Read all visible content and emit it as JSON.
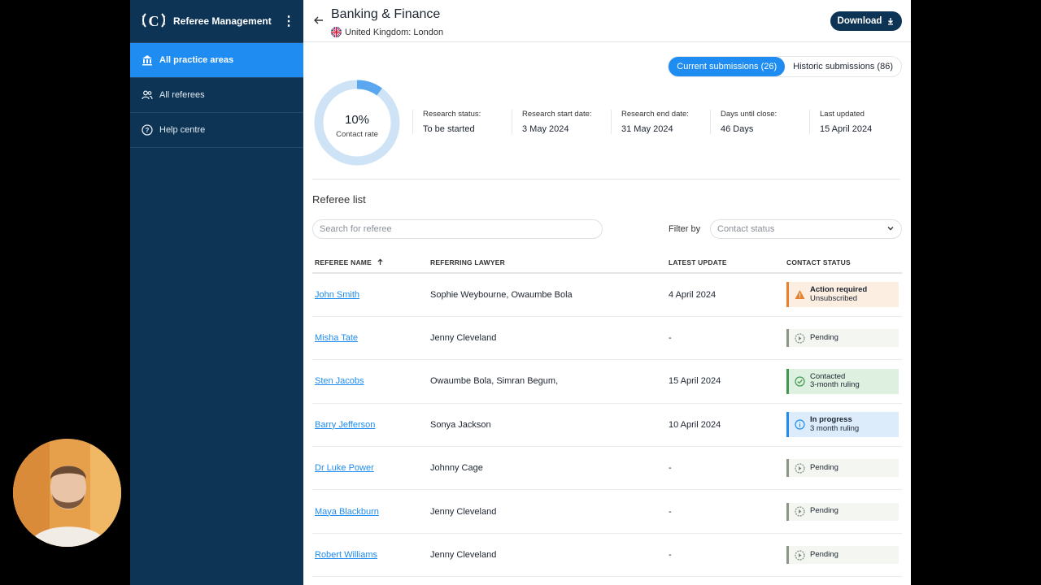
{
  "app": {
    "title": "Referee Management"
  },
  "sidebar": {
    "items": [
      {
        "label": "All practice areas",
        "icon": "bank-icon",
        "active": true
      },
      {
        "label": "All referees",
        "icon": "users-icon",
        "active": false
      },
      {
        "label": "Help centre",
        "icon": "help-icon",
        "active": false
      }
    ]
  },
  "header": {
    "title": "Banking & Finance",
    "location": "United Kingdom: London",
    "download_label": "Download"
  },
  "submissions": {
    "current": "Current submissions (26)",
    "historic": "Historic submissions (86)"
  },
  "contact_rate": {
    "value": "10%",
    "fraction": 0.1,
    "label": "Contact rate"
  },
  "stats": [
    {
      "label": "Research status:",
      "value": "To be started"
    },
    {
      "label": "Research start date:",
      "value": "3 May 2024"
    },
    {
      "label": "Research end date:",
      "value": "31 May 2024"
    },
    {
      "label": "Days until close:",
      "value": "46 Days"
    },
    {
      "label": "Last updated",
      "value": "15 April 2024"
    }
  ],
  "referee_list": {
    "title": "Referee list",
    "search_placeholder": "Search for referee",
    "filter_label": "Filter by",
    "filter_value": "Contact status",
    "columns": [
      "REFEREE NAME",
      "REFERRING LAWYER",
      "LATEST UPDATE",
      "CONTACT STATUS"
    ],
    "rows": [
      {
        "name": "John Smith",
        "lawyer": "Sophie Weybourne, Owaumbe Bola",
        "update": "4 April 2024",
        "status": "Action required",
        "status_sub": "Unsubscribed"
      },
      {
        "name": "Misha Tate",
        "lawyer": "Jenny Cleveland",
        "update": "-",
        "status": "Pending",
        "status_sub": ""
      },
      {
        "name": "Sten Jacobs",
        "lawyer": "Owaumbe Bola, Simran Begum,",
        "update": "15 April 2024",
        "status": "Contacted",
        "status_sub": "3-month ruling"
      },
      {
        "name": "Barry Jefferson",
        "lawyer": "Sonya Jackson",
        "update": "10 April 2024",
        "status": "In progress",
        "status_sub": "3 month ruling"
      },
      {
        "name": "Dr Luke Power",
        "lawyer": "Johnny Cage",
        "update": "-",
        "status": "Pending",
        "status_sub": ""
      },
      {
        "name": "Maya Blackburn",
        "lawyer": "Jenny Cleveland",
        "update": "-",
        "status": "Pending",
        "status_sub": ""
      },
      {
        "name": "Robert Williams",
        "lawyer": "Jenny Cleveland",
        "update": "-",
        "status": "Pending",
        "status_sub": ""
      }
    ]
  },
  "colors": {
    "sidebar": "#0d3455",
    "accent": "#1e8cf0",
    "action": "#e8812e",
    "contacted": "#3f9a4c"
  }
}
